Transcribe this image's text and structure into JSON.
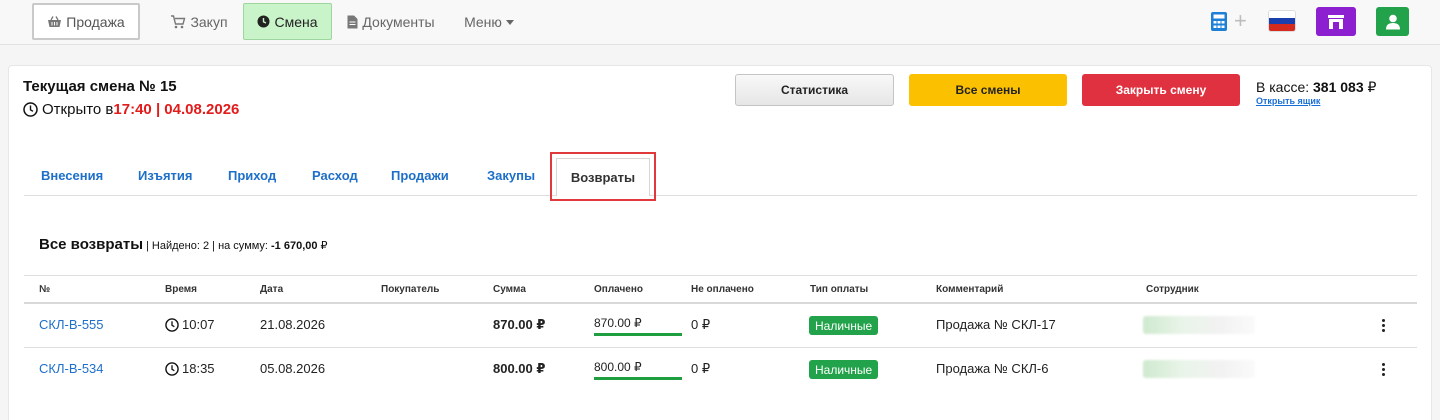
{
  "nav": {
    "sale": "Продажа",
    "purchase": "Закуп",
    "shift": "Смена",
    "documents": "Документы",
    "menu": "Меню",
    "plus": "+"
  },
  "shift": {
    "title": "Текущая смена № 15",
    "opened_prefix": "Открыто в",
    "opened_time": "17:40 | 04.08.2026"
  },
  "buttons": {
    "stats": "Статистика",
    "all_shifts": "Все смены",
    "close_shift": "Закрыть смену"
  },
  "cash": {
    "label": "В кассе:",
    "amount": "381 083",
    "currency": "₽",
    "open_drawer": "Открыть ящик"
  },
  "tabs": [
    "Внесения",
    "Изъятия",
    "Приход",
    "Расход",
    "Продажи",
    "Закупы",
    "Возвраты"
  ],
  "summary": {
    "title": "Все возвраты",
    "found": "| Найдено: 2 | на сумму:",
    "amount": "-1 670,00",
    "currency": "₽"
  },
  "table": {
    "headers": [
      "№",
      "Время",
      "Дата",
      "Покупатель",
      "Сумма",
      "Оплачено",
      "Не оплачено",
      "Тип оплаты",
      "Комментарий",
      "Сотрудник"
    ],
    "rows": [
      {
        "id": "СКЛ-В-555",
        "time": "10:07",
        "date": "21.08.2026",
        "customer": "",
        "sum": "870.00 ₽",
        "paid": "870.00 ₽",
        "unpaid": "0 ₽",
        "payment_type": "Наличные",
        "comment": "Продажа № СКЛ-17"
      },
      {
        "id": "СКЛ-В-534",
        "time": "18:35",
        "date": "05.08.2026",
        "customer": "",
        "sum": "800.00 ₽",
        "paid": "800.00 ₽",
        "unpaid": "0 ₽",
        "payment_type": "Наличные",
        "comment": "Продажа № СКЛ-6"
      }
    ]
  },
  "colors": {
    "accent_blue": "#1e6fc9",
    "yellow": "#fbc100",
    "red": "#e03140",
    "green": "#22a24a",
    "purple": "#8c1fd0"
  },
  "icons": [
    "basket-icon",
    "cart-icon",
    "clock-icon",
    "document-icon",
    "calculator-icon",
    "russia-flag-icon",
    "shop-icon",
    "user-icon",
    "kebab-icon"
  ]
}
